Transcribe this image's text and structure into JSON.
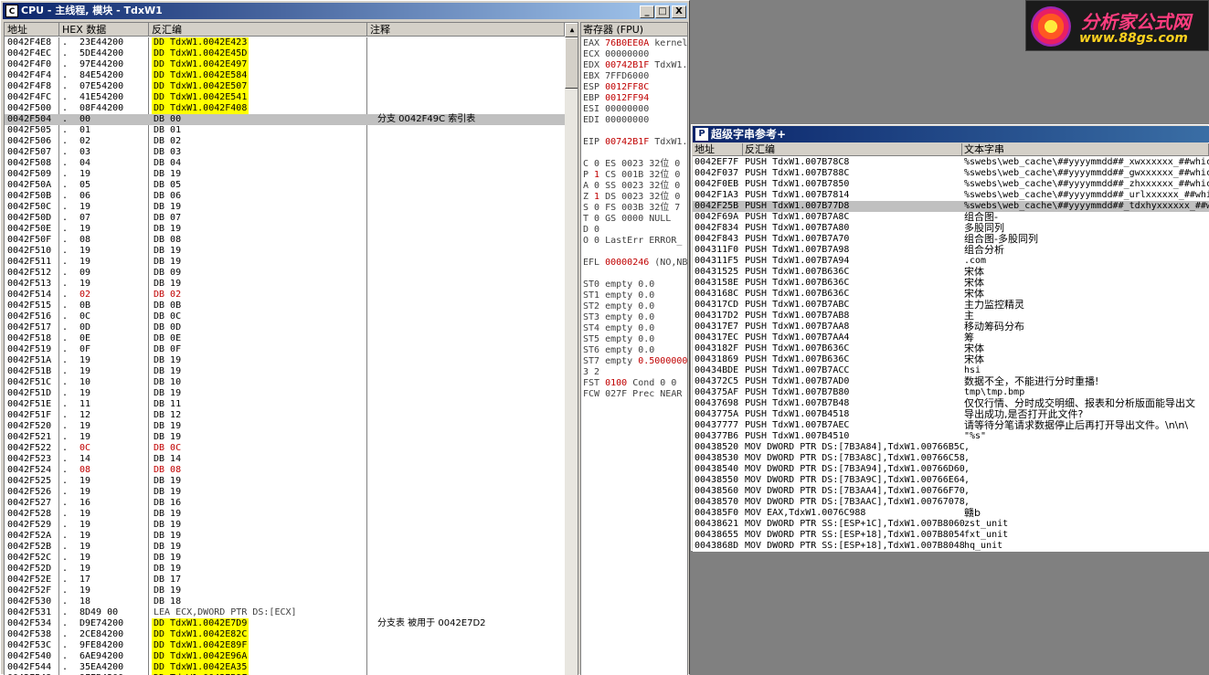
{
  "cpu_window": {
    "title": "CPU - 主线程, 模块 - TdxW1",
    "icon": "C",
    "buttons": {
      "minimize": "_",
      "restore": "□",
      "close": "X"
    },
    "disasm": {
      "headers": {
        "addr": "地址",
        "hex": "HEX 数据",
        "dis": "反汇编",
        "comment": "注释"
      },
      "rows": [
        [
          "0042F4E8",
          ".",
          "23E44200",
          "DD TdxW1.0042E423",
          "",
          1,
          0
        ],
        [
          "0042F4EC",
          ".",
          "5DE44200",
          "DD TdxW1.0042E45D",
          "",
          1,
          0
        ],
        [
          "0042F4F0",
          ".",
          "97E44200",
          "DD TdxW1.0042E497",
          "",
          1,
          0
        ],
        [
          "0042F4F4",
          ".",
          "84E54200",
          "DD TdxW1.0042E584",
          "",
          1,
          0
        ],
        [
          "0042F4F8",
          ".",
          "07E54200",
          "DD TdxW1.0042E507",
          "",
          1,
          0
        ],
        [
          "0042F4FC",
          ".",
          "41E54200",
          "DD TdxW1.0042E541",
          "",
          1,
          0
        ],
        [
          "0042F500",
          ".",
          "08F44200",
          "DD TdxW1.0042F408",
          "",
          1,
          0
        ],
        [
          "0042F504",
          ".",
          "00",
          "DB 00",
          "分支 0042F49C 索引表",
          0,
          2
        ],
        [
          "0042F505",
          ".",
          "01",
          "DB 01",
          "",
          0,
          0
        ],
        [
          "0042F506",
          ".",
          "02",
          "DB 02",
          "",
          0,
          0
        ],
        [
          "0042F507",
          ".",
          "03",
          "DB 03",
          "",
          0,
          0
        ],
        [
          "0042F508",
          ".",
          "04",
          "DB 04",
          "",
          0,
          0
        ],
        [
          "0042F509",
          ".",
          "19",
          "DB 19",
          "",
          0,
          0
        ],
        [
          "0042F50A",
          ".",
          "05",
          "DB 05",
          "",
          0,
          0
        ],
        [
          "0042F50B",
          ".",
          "06",
          "DB 06",
          "",
          0,
          0
        ],
        [
          "0042F50C",
          ".",
          "19",
          "DB 19",
          "",
          0,
          0
        ],
        [
          "0042F50D",
          ".",
          "07",
          "DB 07",
          "",
          0,
          0
        ],
        [
          "0042F50E",
          ".",
          "19",
          "DB 19",
          "",
          0,
          0
        ],
        [
          "0042F50F",
          ".",
          "08",
          "DB 08",
          "",
          0,
          0
        ],
        [
          "0042F510",
          ".",
          "19",
          "DB 19",
          "",
          0,
          0
        ],
        [
          "0042F511",
          ".",
          "19",
          "DB 19",
          "",
          0,
          0
        ],
        [
          "0042F512",
          ".",
          "09",
          "DB 09",
          "",
          0,
          0
        ],
        [
          "0042F513",
          ".",
          "19",
          "DB 19",
          "",
          0,
          0
        ],
        [
          "0042F514",
          ".",
          "02",
          "DB 02",
          "",
          0,
          1
        ],
        [
          "0042F515",
          ".",
          "0B",
          "DB 0B",
          "",
          0,
          0
        ],
        [
          "0042F516",
          ".",
          "0C",
          "DB 0C",
          "",
          0,
          0
        ],
        [
          "0042F517",
          ".",
          "0D",
          "DB 0D",
          "",
          0,
          0
        ],
        [
          "0042F518",
          ".",
          "0E",
          "DB 0E",
          "",
          0,
          0
        ],
        [
          "0042F519",
          ".",
          "0F",
          "DB 0F",
          "",
          0,
          0
        ],
        [
          "0042F51A",
          ".",
          "19",
          "DB 19",
          "",
          0,
          0
        ],
        [
          "0042F51B",
          ".",
          "19",
          "DB 19",
          "",
          0,
          0
        ],
        [
          "0042F51C",
          ".",
          "10",
          "DB 10",
          "",
          0,
          0
        ],
        [
          "0042F51D",
          ".",
          "19",
          "DB 19",
          "",
          0,
          0
        ],
        [
          "0042F51E",
          ".",
          "11",
          "DB 11",
          "",
          0,
          0
        ],
        [
          "0042F51F",
          ".",
          "12",
          "DB 12",
          "",
          0,
          0
        ],
        [
          "0042F520",
          ".",
          "19",
          "DB 19",
          "",
          0,
          0
        ],
        [
          "0042F521",
          ".",
          "19",
          "DB 19",
          "",
          0,
          0
        ],
        [
          "0042F522",
          ".",
          "0C",
          "DB 0C",
          "",
          0,
          1
        ],
        [
          "0042F523",
          ".",
          "14",
          "DB 14",
          "",
          0,
          0
        ],
        [
          "0042F524",
          ".",
          "08",
          "DB 08",
          "",
          0,
          1
        ],
        [
          "0042F525",
          ".",
          "19",
          "DB 19",
          "",
          0,
          0
        ],
        [
          "0042F526",
          ".",
          "19",
          "DB 19",
          "",
          0,
          0
        ],
        [
          "0042F527",
          ".",
          "16",
          "DB 16",
          "",
          0,
          0
        ],
        [
          "0042F528",
          ".",
          "19",
          "DB 19",
          "",
          0,
          0
        ],
        [
          "0042F529",
          ".",
          "19",
          "DB 19",
          "",
          0,
          0
        ],
        [
          "0042F52A",
          ".",
          "19",
          "DB 19",
          "",
          0,
          0
        ],
        [
          "0042F52B",
          ".",
          "19",
          "DB 19",
          "",
          0,
          0
        ],
        [
          "0042F52C",
          ".",
          "19",
          "DB 19",
          "",
          0,
          0
        ],
        [
          "0042F52D",
          ".",
          "19",
          "DB 19",
          "",
          0,
          0
        ],
        [
          "0042F52E",
          ".",
          "17",
          "DB 17",
          "",
          0,
          0
        ],
        [
          "0042F52F",
          ".",
          "19",
          "DB 19",
          "",
          0,
          0
        ],
        [
          "0042F530",
          ".",
          "18",
          "DB 18",
          "",
          0,
          0
        ],
        [
          "0042F531",
          ".",
          "8D49 00",
          "LEA ECX,DWORD PTR DS:[ECX]",
          "",
          0,
          3
        ],
        [
          "0042F534",
          ".",
          "D9E74200",
          "DD TdxW1.0042E7D9",
          "分支表 被用于 0042E7D2",
          1,
          0
        ],
        [
          "0042F538",
          ".",
          "2CE84200",
          "DD TdxW1.0042E82C",
          "",
          1,
          0
        ],
        [
          "0042F53C",
          ".",
          "9FE84200",
          "DD TdxW1.0042E89F",
          "",
          1,
          0
        ],
        [
          "0042F540",
          ".",
          "6AE94200",
          "DD TdxW1.0042E96A",
          "",
          1,
          0
        ],
        [
          "0042F544",
          ".",
          "35EA4200",
          "DD TdxW1.0042EA35",
          "",
          1,
          0
        ],
        [
          "0042F548",
          ".",
          "9FEB4200",
          "DD TdxW1.0042EB9F",
          "",
          1,
          0
        ]
      ]
    },
    "registers": {
      "header": "寄存器 (FPU)",
      "lines": [
        {
          "t": "EAX ",
          "v": "76B0EE0A",
          "r": " kernel"
        },
        {
          "t": "ECX 00000000",
          "v": "",
          "r": ""
        },
        {
          "t": "EDX ",
          "v": "00742B1F",
          "r": " TdxW1."
        },
        {
          "t": "EBX 7FFD6000",
          "v": "",
          "r": ""
        },
        {
          "t": "ESP ",
          "v": "0012FF8C",
          "r": ""
        },
        {
          "t": "EBP ",
          "v": "0012FF94",
          "r": ""
        },
        {
          "t": "ESI 00000000",
          "v": "",
          "r": ""
        },
        {
          "t": "EDI 00000000",
          "v": "",
          "r": ""
        },
        {
          "t": "",
          "v": "",
          "r": ""
        },
        {
          "t": "EIP ",
          "v": "00742B1F",
          "r": " TdxW1."
        },
        {
          "t": "",
          "v": "",
          "r": ""
        },
        {
          "t": "C 0  ES 0023 32位 0",
          "v": "",
          "r": ""
        },
        {
          "t": "P ",
          "v": "1",
          "r": "  CS 001B 32位 0"
        },
        {
          "t": "A 0  SS 0023 32位 0",
          "v": "",
          "r": ""
        },
        {
          "t": "Z ",
          "v": "1",
          "r": "  DS 0023 32位 0"
        },
        {
          "t": "S 0  FS 003B 32位 7",
          "v": "",
          "r": ""
        },
        {
          "t": "T 0  GS 0000 NULL",
          "v": "",
          "r": ""
        },
        {
          "t": "D 0",
          "v": "",
          "r": ""
        },
        {
          "t": "O 0  LastErr ERROR_",
          "v": "",
          "r": ""
        },
        {
          "t": "",
          "v": "",
          "r": ""
        },
        {
          "t": "EFL ",
          "v": "00000246",
          "r": " (NO,NB"
        },
        {
          "t": "",
          "v": "",
          "r": ""
        },
        {
          "t": "ST0 empty 0.0",
          "v": "",
          "r": ""
        },
        {
          "t": "ST1 empty 0.0",
          "v": "",
          "r": ""
        },
        {
          "t": "ST2 empty 0.0",
          "v": "",
          "r": ""
        },
        {
          "t": "ST3 empty 0.0",
          "v": "",
          "r": ""
        },
        {
          "t": "ST4 empty 0.0",
          "v": "",
          "r": ""
        },
        {
          "t": "ST5 empty 0.0",
          "v": "",
          "r": ""
        },
        {
          "t": "ST6 empty 0.0",
          "v": "",
          "r": ""
        },
        {
          "t": "ST7 empty ",
          "v": "0.5000000",
          "r": ""
        },
        {
          "t": "               3 2",
          "v": "",
          "r": ""
        },
        {
          "t": "FST ",
          "v": "0100",
          "r": "  Cond 0 0"
        },
        {
          "t": "FCW 027F  Prec NEAR",
          "v": "",
          "r": ""
        }
      ]
    }
  },
  "logo": {
    "line1": "分析家公式网",
    "line2": "www.88gs.com"
  },
  "string_window": {
    "title": "超级字串参考+",
    "icon": "P",
    "headers": {
      "addr": "地址",
      "dis": "反汇编",
      "text": "文本字串"
    },
    "rows": [
      [
        "0042EF7F",
        "PUSH TdxW1.007B78C8",
        "%swebs\\web_cache\\##yyyymmdd##_xwxxxxxx_##whic",
        0
      ],
      [
        "0042F037",
        "PUSH TdxW1.007B788C",
        "%swebs\\web_cache\\##yyyymmdd##_gwxxxxxx_##whic",
        0
      ],
      [
        "0042F0EB",
        "PUSH TdxW1.007B7850",
        "%swebs\\web_cache\\##yyyymmdd##_zhxxxxxx_##whic",
        0
      ],
      [
        "0042F1A3",
        "PUSH TdxW1.007B7814",
        "%swebs\\web_cache\\##yyyymmdd##_urlxxxxxx_##whi",
        0
      ],
      [
        "0042F25B",
        "PUSH TdxW1.007B77D8",
        "%swebs\\web_cache\\##yyyymmdd##_tdxhyxxxxxx_##w",
        1
      ],
      [
        "0042F69A",
        "PUSH TdxW1.007B7A8C",
        "组合图-",
        0
      ],
      [
        "0042F834",
        "PUSH TdxW1.007B7A80",
        "多股同列",
        0
      ],
      [
        "0042F843",
        "PUSH TdxW1.007B7A70",
        "组合图-多股同列",
        0
      ],
      [
        "004311F0",
        "PUSH TdxW1.007B7A98",
        "组合分析",
        0
      ],
      [
        "004311F5",
        "PUSH TdxW1.007B7A94",
        ".com",
        0
      ],
      [
        "00431525",
        "PUSH TdxW1.007B636C",
        "宋体",
        0
      ],
      [
        "0043158E",
        "PUSH TdxW1.007B636C",
        "宋体",
        0
      ],
      [
        "0043168C",
        "PUSH TdxW1.007B636C",
        "宋体",
        0
      ],
      [
        "004317CD",
        "PUSH TdxW1.007B7ABC",
        "主力监控精灵",
        0
      ],
      [
        "004317D2",
        "PUSH TdxW1.007B7AB8",
        "主",
        0
      ],
      [
        "004317E7",
        "PUSH TdxW1.007B7AA8",
        "移动筹码分布",
        0
      ],
      [
        "004317EC",
        "PUSH TdxW1.007B7AA4",
        "筹",
        0
      ],
      [
        "0043182F",
        "PUSH TdxW1.007B636C",
        "宋体",
        0
      ],
      [
        "00431869",
        "PUSH TdxW1.007B636C",
        "宋体",
        0
      ],
      [
        "00434BDE",
        "PUSH TdxW1.007B7ACC",
        "hsi",
        0
      ],
      [
        "004372C5",
        "PUSH TdxW1.007B7AD0",
        "数据不全，不能进行分时重播!",
        0
      ],
      [
        "004375AF",
        "PUSH TdxW1.007B7B80",
        "tmp\\tmp.bmp",
        0
      ],
      [
        "00437698",
        "PUSH TdxW1.007B7B48",
        "仅仅行情、分时成交明细、报表和分析版面能导出文",
        0
      ],
      [
        "0043775A",
        "PUSH TdxW1.007B4518",
        "导出成功,是否打开此文件?",
        0
      ],
      [
        "00437777",
        "PUSH TdxW1.007B7AEC",
        "请等待分笔请求数据停止后再打开导出文件。\\n\\n\\",
        0
      ],
      [
        "004377B6",
        "PUSH TdxW1.007B4510",
        "\"%s\"",
        0
      ],
      [
        "00438520",
        "MOV DWORD PTR DS:[7B3A84],TdxW1.00766B5C",
        ",",
        0
      ],
      [
        "00438530",
        "MOV DWORD PTR DS:[7B3A8C],TdxW1.00766C58",
        ",",
        0
      ],
      [
        "00438540",
        "MOV DWORD PTR DS:[7B3A94],TdxW1.00766D60",
        ",",
        0
      ],
      [
        "00438550",
        "MOV DWORD PTR DS:[7B3A9C],TdxW1.00766E64",
        ",",
        0
      ],
      [
        "00438560",
        "MOV DWORD PTR DS:[7B3AA4],TdxW1.00766F70",
        ",",
        0
      ],
      [
        "00438570",
        "MOV DWORD PTR DS:[7B3AAC],TdxW1.00767078",
        ",",
        0
      ],
      [
        "004385F0",
        "MOV EAX,TdxW1.0076C988",
        "赣b",
        0
      ],
      [
        "00438621",
        "MOV DWORD PTR SS:[ESP+1C],TdxW1.007B8060",
        "zst_unit",
        0
      ],
      [
        "00438655",
        "MOV DWORD PTR SS:[ESP+18],TdxW1.007B8054",
        "fxt_unit",
        0
      ],
      [
        "0043868D",
        "MOV DWORD PTR SS:[ESP+18],TdxW1.007B8048",
        "hq_unit",
        0
      ],
      [
        "004386C5",
        "MOV DWORD PTR SS:[ESP+18],TdxW1.007B803C",
        "",
        0
      ]
    ]
  }
}
